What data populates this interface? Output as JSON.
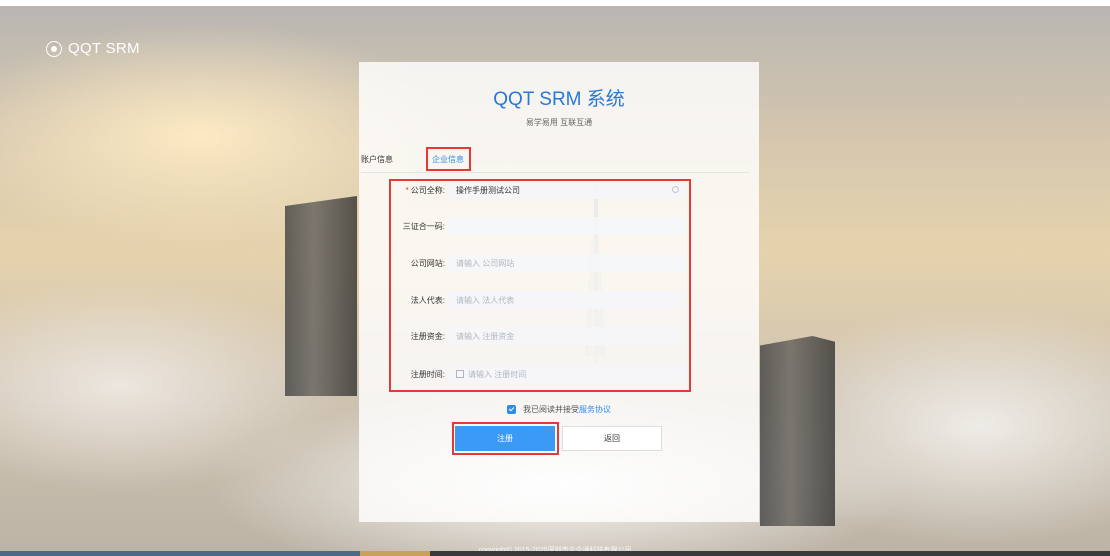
{
  "app": {
    "logo_text": "QQT SRM"
  },
  "card": {
    "title": "QQT SRM 系统",
    "subtitle": "易学易用 互联互通"
  },
  "tabs": [
    {
      "label": "账户信息",
      "active": false
    },
    {
      "label": "企业信息",
      "active": true
    }
  ],
  "form": {
    "fields": [
      {
        "label": "公司全称:",
        "required": true,
        "value": "操作手册测试公司",
        "placeholder": ""
      },
      {
        "label": "三证合一码:",
        "required": false,
        "value": "",
        "placeholder": ""
      },
      {
        "label": "公司网站:",
        "required": false,
        "value": "",
        "placeholder": "请输入 公司网站"
      },
      {
        "label": "法人代表:",
        "required": false,
        "value": "",
        "placeholder": "请输入 法人代表"
      },
      {
        "label": "注册资金:",
        "required": false,
        "value": "",
        "placeholder": "请输入 注册资金"
      },
      {
        "label": "注册时间:",
        "required": false,
        "value": "",
        "placeholder": "请输入 注册时间"
      }
    ]
  },
  "agreement": {
    "checked": true,
    "text": "我已阅读并接受",
    "link": "服务协议"
  },
  "buttons": {
    "register": "注册",
    "back": "返回"
  },
  "footer": {
    "copyright": "copyright© 2015-2020深圳市企企通科技有限公司"
  },
  "colors": {
    "accent": "#2b8cf0",
    "primary_button": "#3b9af6",
    "highlight": "#e53935"
  }
}
